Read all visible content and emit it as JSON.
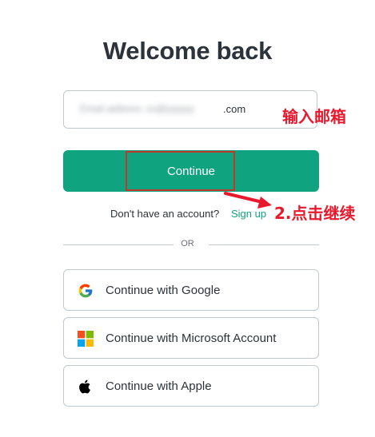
{
  "heading": "Welcome back",
  "email": {
    "blurred_value": "Email address: xx@yyyyyy",
    "suffix": ".com"
  },
  "annotations": {
    "step1": "输入邮箱",
    "step2": "2.点击继续",
    "color": "#e8192c"
  },
  "continue_label": "Continue",
  "signup": {
    "prompt": "Don't have an account?",
    "link": "Sign up"
  },
  "divider_label": "OR",
  "social": {
    "google": "Continue with Google",
    "microsoft": "Continue with Microsoft Account",
    "apple": "Continue with Apple"
  },
  "colors": {
    "brand": "#10a37f",
    "text": "#2d333a",
    "border": "#c2c8d0",
    "highlight": "#c0392b"
  },
  "icons": [
    "google-icon",
    "microsoft-icon",
    "apple-icon"
  ]
}
